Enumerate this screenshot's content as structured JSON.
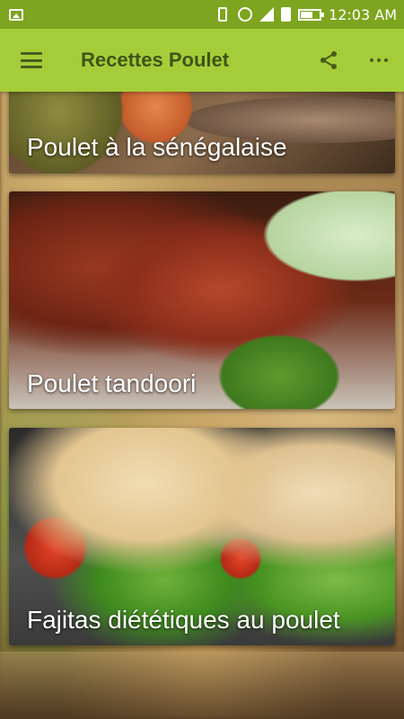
{
  "status_bar": {
    "time": "12:03 AM",
    "icons": [
      "image-icon",
      "vibrate-icon",
      "alarm-icon",
      "signal-icon",
      "sim-icon",
      "battery-icon"
    ]
  },
  "app_bar": {
    "title": "Recettes Poulet",
    "menu_icon": "menu-icon",
    "share_icon": "share-icon",
    "overflow_icon": "more-icon",
    "background_color": "#a5cd39",
    "title_color": "#3f5418"
  },
  "recipes": [
    {
      "title": "Poulet à la sénégalaise"
    },
    {
      "title": "Poulet tandoori"
    },
    {
      "title": "Fajitas diététiques au poulet"
    }
  ]
}
